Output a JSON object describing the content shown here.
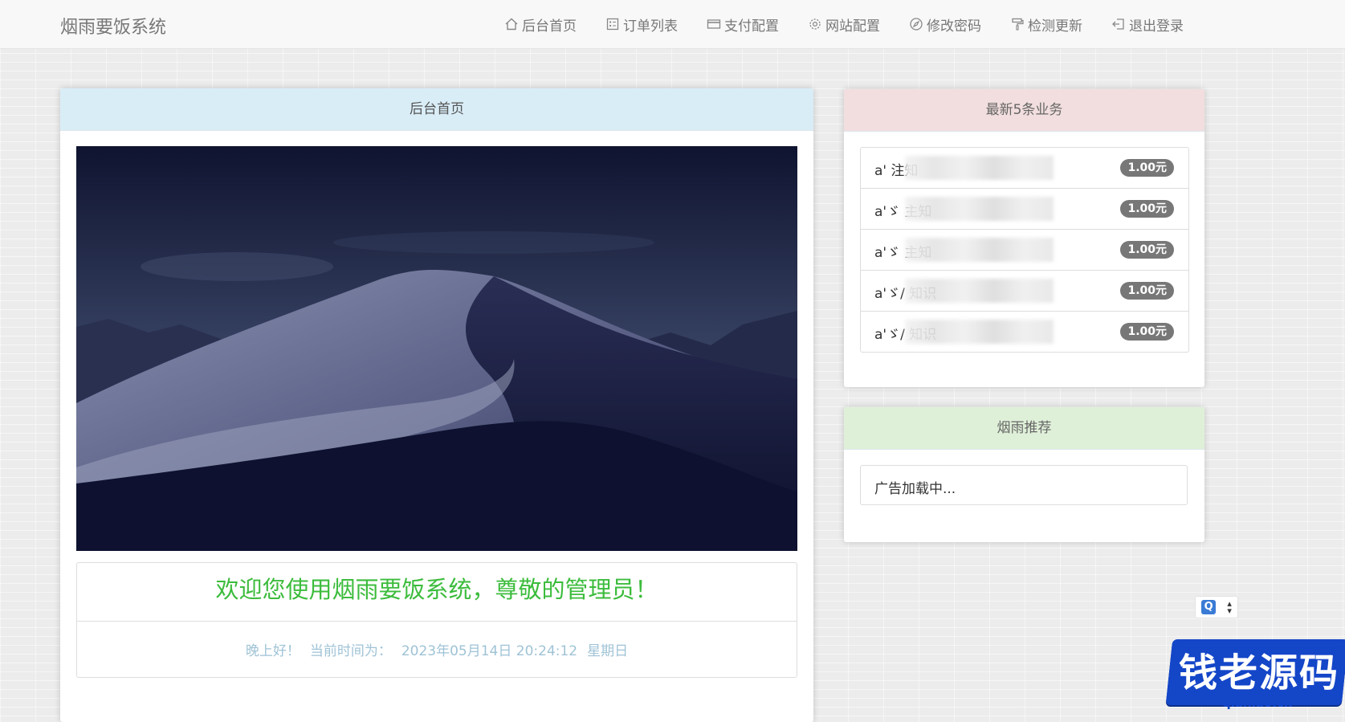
{
  "navbar": {
    "brand": "烟雨要饭系统",
    "items": [
      {
        "label": "后台首页",
        "icon": "home-icon"
      },
      {
        "label": "订单列表",
        "icon": "list-icon"
      },
      {
        "label": "支付配置",
        "icon": "credit-card-icon"
      },
      {
        "label": "网站配置",
        "icon": "gear-icon"
      },
      {
        "label": "修改密码",
        "icon": "compass-icon"
      },
      {
        "label": "检测更新",
        "icon": "paint-roller-icon"
      },
      {
        "label": "退出登录",
        "icon": "logout-icon"
      }
    ]
  },
  "main": {
    "heading": "后台首页",
    "hero_image": "desert-dunes-night-image",
    "welcome_title": "欢迎您使用烟雨要饭系统，尊敬的管理员！",
    "greeting": "晚上好！",
    "time_label": "当前时间为：",
    "datetime": "2023年05月14日 20:24:12",
    "weekday": "星期日"
  },
  "recent": {
    "heading": "最新5条业务",
    "items": [
      {
        "text": "a'         注知",
        "amount": "1.00元"
      },
      {
        "text": "a'ゞ        主知",
        "amount": "1.00元"
      },
      {
        "text": "a'ゞ        主知",
        "amount": "1.00元"
      },
      {
        "text": "a'ゞ/       知识",
        "amount": "1.00元"
      },
      {
        "text": "a'ゞ/       知识",
        "amount": "1.00元"
      }
    ]
  },
  "promo": {
    "heading": "烟雨推荐",
    "ad_text": "广告加载中..."
  },
  "watermark": {
    "title": "钱老源码",
    "url": "qianlao.cn"
  },
  "colors": {
    "welcome_green": "#3cbc3c",
    "time_blue": "#9fc3d6",
    "info_heading": "#d9edf7",
    "danger_heading": "#f2dede",
    "success_heading": "#dff0d8",
    "badge_gray": "#777777",
    "watermark_blue": "#1446c8"
  }
}
